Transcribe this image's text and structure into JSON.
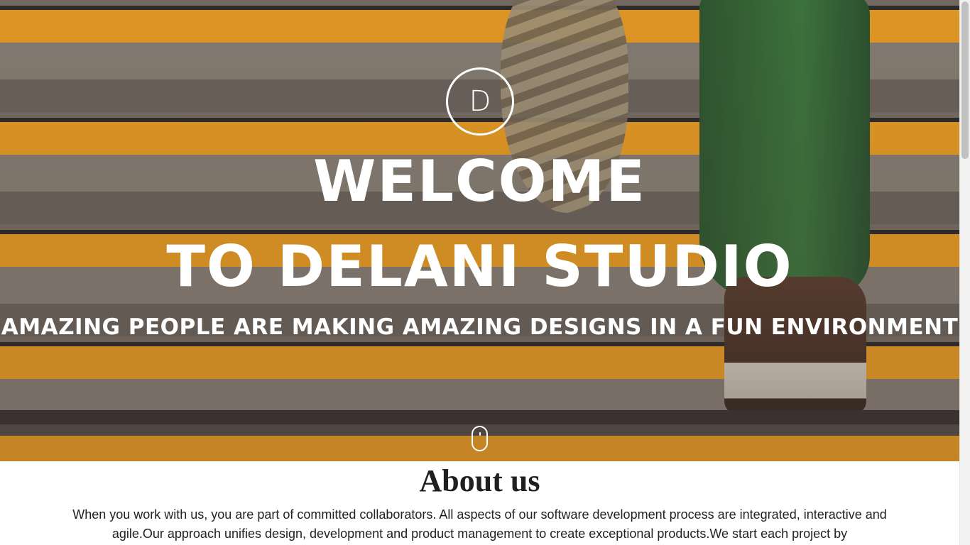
{
  "hero": {
    "logo_letter": "D",
    "title_line1": "Welcome",
    "title_line2": "to Delani Studio",
    "subtitle": "Amazing people are making amazing designs in a fun environment",
    "scroll_icon": "mouse-scroll-icon"
  },
  "about": {
    "heading": "About us",
    "text": "When you work with us, you are part of committed collaborators. All aspects of our software development process are integrated, interactive and agile.Our approach unifies design, development and product management to create exceptional products.We start each project by"
  },
  "colors": {
    "accent_orange": "#f2a324",
    "text_white": "#ffffff",
    "heading_dark": "#1f1f1f"
  }
}
